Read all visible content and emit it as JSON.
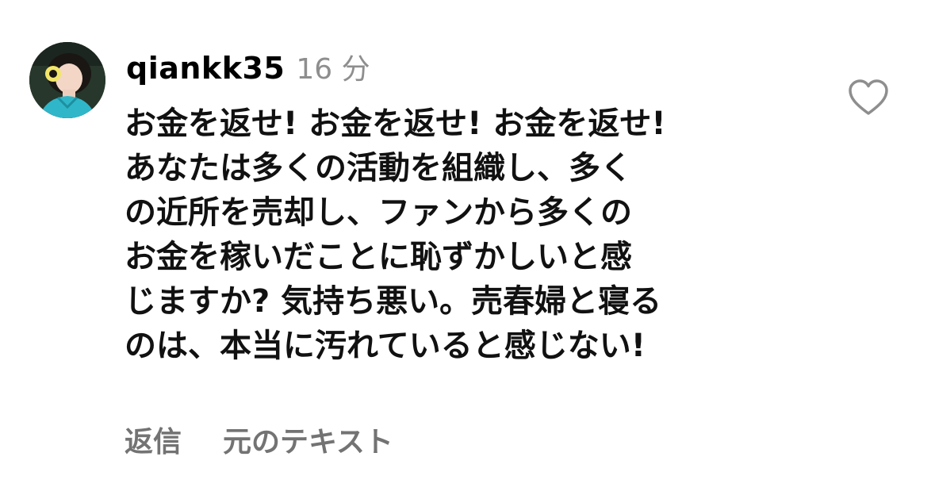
{
  "comment": {
    "username": "qiankk35",
    "timestamp": "16 分",
    "text": "お金を返せ! お金を返せ! お金を返せ!\nあなたは多くの活動を組織し、多く\nの近所を売却し、ファンから多くの\nお金を稼いだことに恥ずかしいと感\nじますか? 気持ち悪い。売春婦と寝る\nのは、本当に汚れていると感じない!",
    "avatar": "profile-photo",
    "like_icon": "heart-outline-icon"
  },
  "actions": {
    "reply_label": "返信",
    "original_text_label": "元のテキスト"
  },
  "colors": {
    "text": "#111111",
    "secondary": "#8e8e8e",
    "action": "#737373",
    "icon_stroke": "#8e8e8e"
  }
}
